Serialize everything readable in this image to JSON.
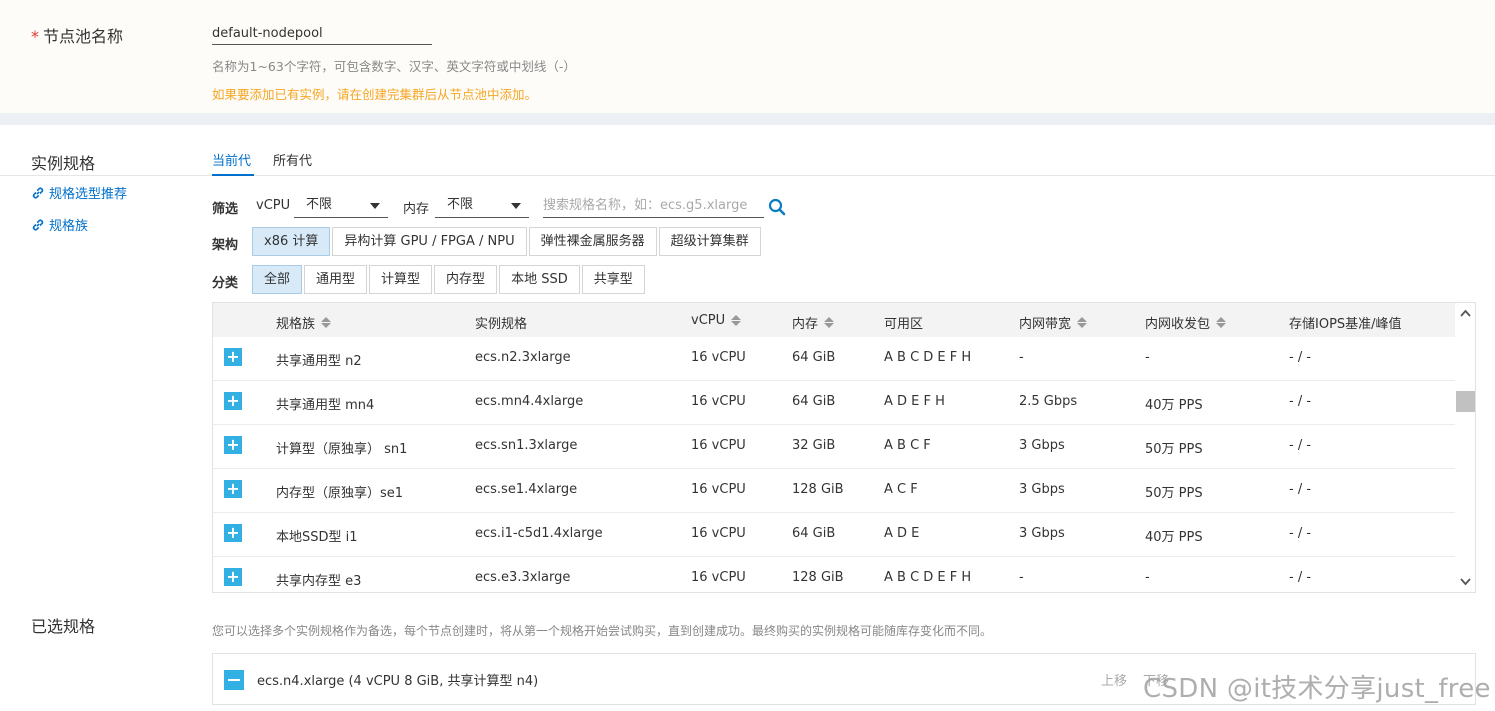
{
  "nodepool": {
    "required_mark": "*",
    "label": "节点池名称",
    "value": "default-nodepool",
    "hint": "名称为1~63个字符，可包含数字、汉字、英文字符或中划线（-）",
    "warning": "如果要添加已有实例，请在创建完集群后从节点池中添加。"
  },
  "spec": {
    "label": "实例规格",
    "links": [
      "规格选型推荐",
      "规格族"
    ],
    "tabs": [
      "当前代",
      "所有代"
    ],
    "filter": {
      "label": "筛选",
      "vcpu_label": "vCPU",
      "vcpu_value": "不限",
      "mem_label": "内存",
      "mem_value": "不限",
      "search_placeholder": "搜索规格名称，如：ecs.g5.xlarge"
    },
    "arch": {
      "label": "架构",
      "options": [
        "x86 计算",
        "异构计算 GPU / FPGA / NPU",
        "弹性裸金属服务器",
        "超级计算集群"
      ],
      "selected": "x86 计算"
    },
    "category": {
      "label": "分类",
      "options": [
        "全部",
        "通用型",
        "计算型",
        "内存型",
        "本地 SSD",
        "共享型"
      ],
      "selected": "全部"
    },
    "table": {
      "headers": [
        "规格族",
        "实例规格",
        "vCPU",
        "内存",
        "可用区",
        "内网带宽",
        "内网收发包",
        "存储IOPS基准/峰值"
      ],
      "rows": [
        [
          "共享通用型 n2",
          "ecs.n2.3xlarge",
          "16 vCPU",
          "64 GiB",
          "A B C D E F H",
          "-",
          "-",
          "- / -"
        ],
        [
          "共享通用型 mn4",
          "ecs.mn4.4xlarge",
          "16 vCPU",
          "64 GiB",
          "A D E F H",
          "2.5 Gbps",
          "40万 PPS",
          "- / -"
        ],
        [
          "计算型（原独享） sn1",
          "ecs.sn1.3xlarge",
          "16 vCPU",
          "32 GiB",
          "A B C F",
          "3 Gbps",
          "50万 PPS",
          "- / -"
        ],
        [
          "内存型（原独享）se1",
          "ecs.se1.4xlarge",
          "16 vCPU",
          "128 GiB",
          "A C F",
          "3 Gbps",
          "50万 PPS",
          "- / -"
        ],
        [
          "本地SSD型 i1",
          "ecs.i1-c5d1.4xlarge",
          "16 vCPU",
          "64 GiB",
          "A D E",
          "3 Gbps",
          "40万 PPS",
          "- / -"
        ],
        [
          "共享内存型 e3",
          "ecs.e3.3xlarge",
          "16 vCPU",
          "128 GiB",
          "A B C D E F H",
          "-",
          "-",
          "- / -"
        ]
      ]
    }
  },
  "selected": {
    "label": "已选规格",
    "hint": "您可以选择多个实例规格作为备选，每个节点创建时，将从第一个规格开始尝试购买，直到创建成功。最终购买的实例规格可能随库存变化而不同。",
    "item": "ecs.n4.xlarge (4 vCPU 8 GiB, 共享计算型 n4)",
    "move_up": "上移",
    "move_down": "下移"
  },
  "watermark": "CSDN @it技术分享just_free",
  "colors": {
    "accent": "#0070cc",
    "warning": "#f5a623",
    "add": "#33b0e3"
  }
}
